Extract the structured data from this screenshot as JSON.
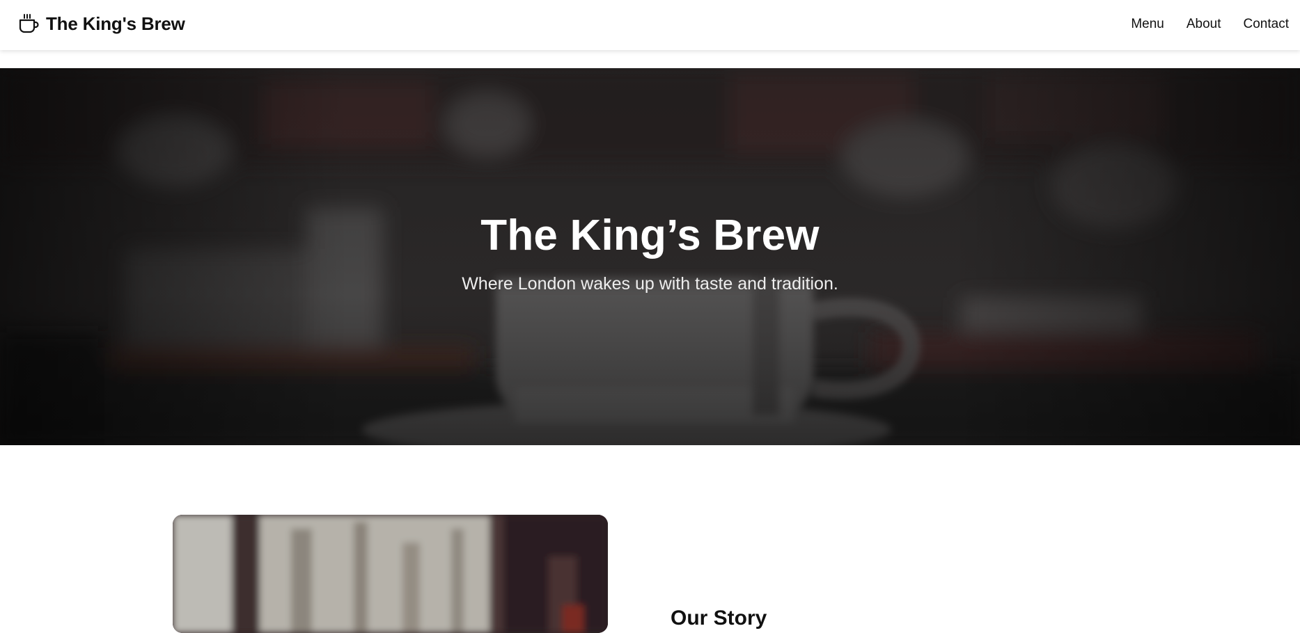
{
  "header": {
    "brand_icon": "coffee-cup-icon",
    "brand_name": "The King's Brew",
    "nav": [
      {
        "label": "Menu"
      },
      {
        "label": "About"
      },
      {
        "label": "Contact"
      }
    ]
  },
  "hero": {
    "title": "The King’s Brew",
    "subtitle": "Where London wakes up with taste and tradition.",
    "background": "blurred-coffee-cup-photo"
  },
  "story": {
    "image": "blurred-window-interior-photo",
    "heading": "Our Story"
  }
}
